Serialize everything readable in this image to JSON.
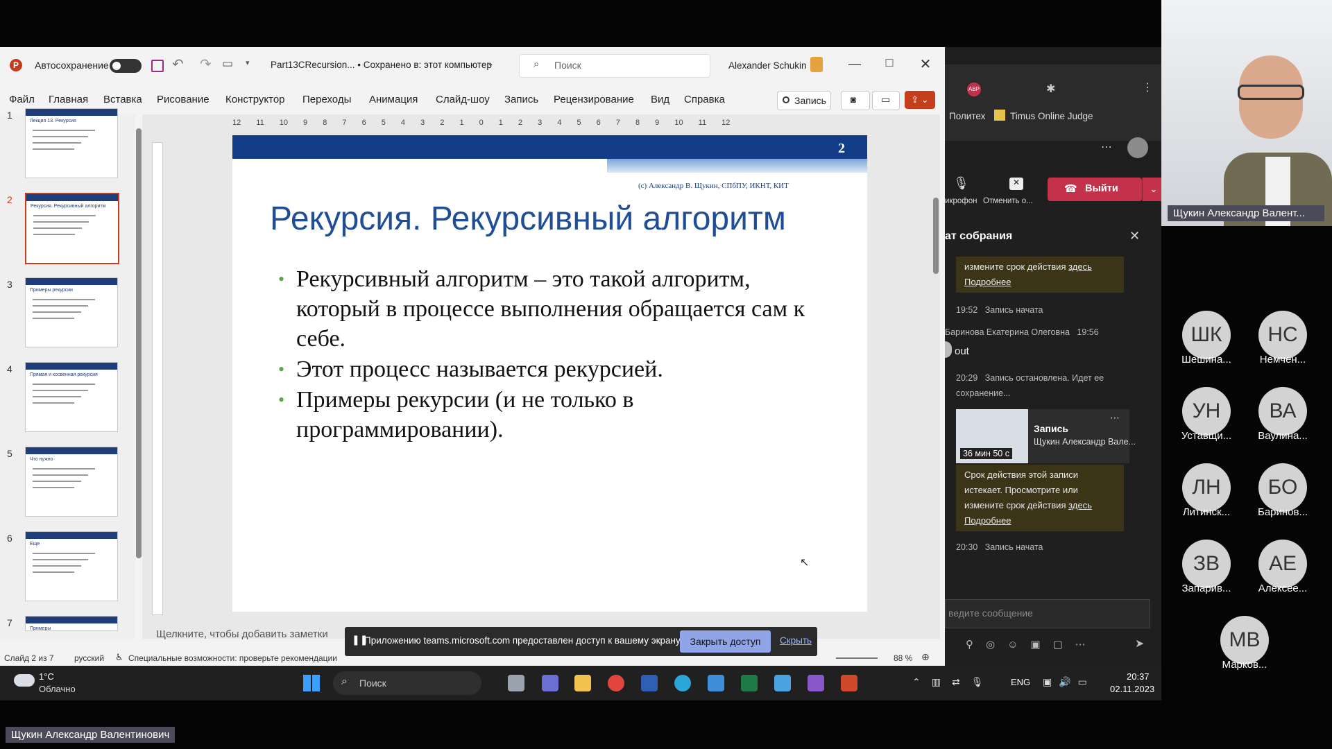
{
  "powerpoint": {
    "autosave_label": "Автосохранение",
    "file_title": "Part13CRecursion... • Сохранено в: этот компьютер",
    "search_placeholder": "Поиск",
    "user_name": "Alexander Schukin",
    "menu": [
      "Файл",
      "Главная",
      "Вставка",
      "Рисование",
      "Конструктор",
      "Переходы",
      "Анимация",
      "Слайд-шоу",
      "Запись",
      "Рецензирование",
      "Вид",
      "Справка"
    ],
    "record_button": "Запись",
    "ruler_numbers": "12 11 10 9 8 7 6 5 4 3 2 1 0 1 2 3 4 5 6 7 8 9 10 11 12",
    "thumbnails": [
      {
        "num": "1",
        "title": "Лекция 13. Рекурсия"
      },
      {
        "num": "2",
        "title": "Рекурсия. Рекурсивный алгоритм"
      },
      {
        "num": "3",
        "title": "Примеры рекурсии"
      },
      {
        "num": "4",
        "title": "Прямая и косвенная рекурсия"
      },
      {
        "num": "5",
        "title": "Что нужно"
      },
      {
        "num": "6",
        "title": "Еще"
      },
      {
        "num": "7",
        "title": "Примеры"
      }
    ],
    "slide": {
      "page_number": "2",
      "copyright": "(c) Александр В. Щукин, СПбПУ, ИКНТ, КИТ",
      "title": "Рекурсия. Рекурсивный алгоритм",
      "bullets": [
        "Рекурсивный алгоритм – это такой алгоритм, который в процессе выполнения обращается сам к себе.",
        "Этот процесс называется рекурсией.",
        "Примеры рекурсии (и не только в программировании)."
      ]
    },
    "notes_placeholder": "Щелкните, чтобы добавить заметки",
    "status": {
      "slide_info": "Слайд 2 из 7",
      "language": "русский",
      "accessibility": "Специальные возможности: проверьте рекомендации",
      "zoom": "88 %"
    },
    "share_bar": {
      "message": "Приложению teams.microsoft.com предоставлен доступ к вашему экрану.",
      "stop_button": "Закрыть доступ",
      "hide_link": "Скрыть"
    }
  },
  "teams": {
    "bookmarks": [
      "Политех",
      "Timus Online Judge"
    ],
    "mic_label": "икрофон",
    "cancel_label": "Отменить о...",
    "leave_button": "Выйти",
    "chat_title": "ат собрания",
    "messages": {
      "expiry_top_1": "измените срок действия",
      "link_here": "здесь",
      "link_more": "Подробнее",
      "rec_started_1_time": "19:52",
      "rec_started_1_text": "Запись начата",
      "author": "Баринова Екатерина Олеговна",
      "author_time": "19:56",
      "author_msg": "out",
      "rec_stopped_time": "20:29",
      "rec_stopped_text": "Запись остановлена. Идет ее сохранение...",
      "rec_card_title": "Запись",
      "rec_card_sub": "Щукин Александр Вале...",
      "rec_duration": "36 мин 50 с",
      "expiry_1": "Срок действия этой записи",
      "expiry_2": "истекает. Просмотрите или",
      "expiry_3": "измените срок действия",
      "rec_started_2_time": "20:30",
      "rec_started_2_text": "Запись начата"
    },
    "compose_placeholder": "ведите сообщение"
  },
  "participants": [
    {
      "initials": "ШК",
      "name": "Шешина..."
    },
    {
      "initials": "НС",
      "name": "Немчен..."
    },
    {
      "initials": "УН",
      "name": "Уставщи..."
    },
    {
      "initials": "ВА",
      "name": "Ваулина..."
    },
    {
      "initials": "ЛН",
      "name": "Литинск..."
    },
    {
      "initials": "БО",
      "name": "Баринов..."
    },
    {
      "initials": "ЗВ",
      "name": "Запарив..."
    },
    {
      "initials": "АЕ",
      "name": "Алексее..."
    },
    {
      "initials": "МВ",
      "name": "Марков..."
    }
  ],
  "presenter": {
    "video_name": "Щукин Александр Валент...",
    "bottom_name": "Щукин Александр Валентинович"
  },
  "taskbar": {
    "weather_temp": "1°C",
    "weather_desc": "Облачно",
    "search": "Поиск",
    "lang": "ENG",
    "time": "20:37",
    "date": "02.11.2023"
  },
  "colors": {
    "slide_blue": "#123c86",
    "title_blue": "#1f4e96",
    "leave_red": "#c4314b",
    "ppt_accent": "#c43e1c"
  }
}
